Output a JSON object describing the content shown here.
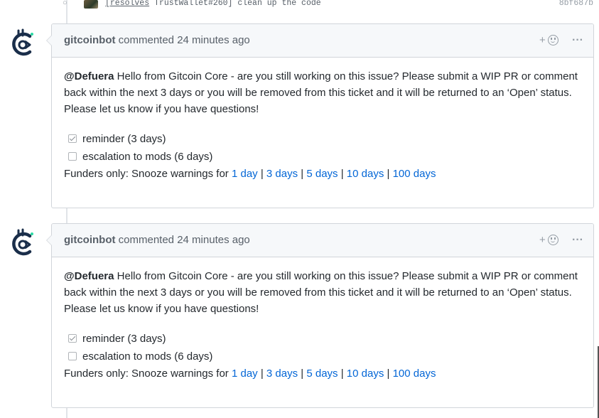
{
  "commit": {
    "message_prefix": "[resolves",
    "message_rest": " TrustWallet#260] clean up the code",
    "sha": "8bf687b",
    "icon": "commit-dot-icon"
  },
  "comments": [
    {
      "author": "gitcoinbot",
      "action": "commented",
      "time": "24 minutes ago",
      "mention": "@Defuera",
      "body": " Hello from Gitcoin Core - are you still working on this issue? Please submit a WIP PR or comment back within the next 3 days or you will be removed from this ticket and it will be returned to an ‘Open’ status. Please let us know if you have questions!",
      "tasks": [
        {
          "label": "reminder (3 days)",
          "checked": true
        },
        {
          "label": "escalation to mods (6 days)",
          "checked": false
        }
      ],
      "funders_label": "Funders only: Snooze warnings for ",
      "snooze": [
        "1 day",
        "3 days",
        "5 days",
        "10 days",
        "100 days"
      ],
      "separator": " | ",
      "more": "···",
      "react_plus": "+"
    },
    {
      "author": "gitcoinbot",
      "action": "commented",
      "time": "24 minutes ago",
      "mention": "@Defuera",
      "body": " Hello from Gitcoin Core - are you still working on this issue? Please submit a WIP PR or comment back within the next 3 days or you will be removed from this ticket and it will be returned to an ‘Open’ status. Please let us know if you have questions!",
      "tasks": [
        {
          "label": "reminder (3 days)",
          "checked": true
        },
        {
          "label": "escalation to mods (6 days)",
          "checked": false
        }
      ],
      "funders_label": "Funders only: Snooze warnings for ",
      "snooze": [
        "1 day",
        "3 days",
        "5 days",
        "10 days",
        "100 days"
      ],
      "separator": " | ",
      "more": "···",
      "react_plus": "+"
    }
  ],
  "colors": {
    "link": "#0366d6",
    "logo_dark": "#1a2e4a",
    "logo_accent": "#2bd9a4"
  }
}
